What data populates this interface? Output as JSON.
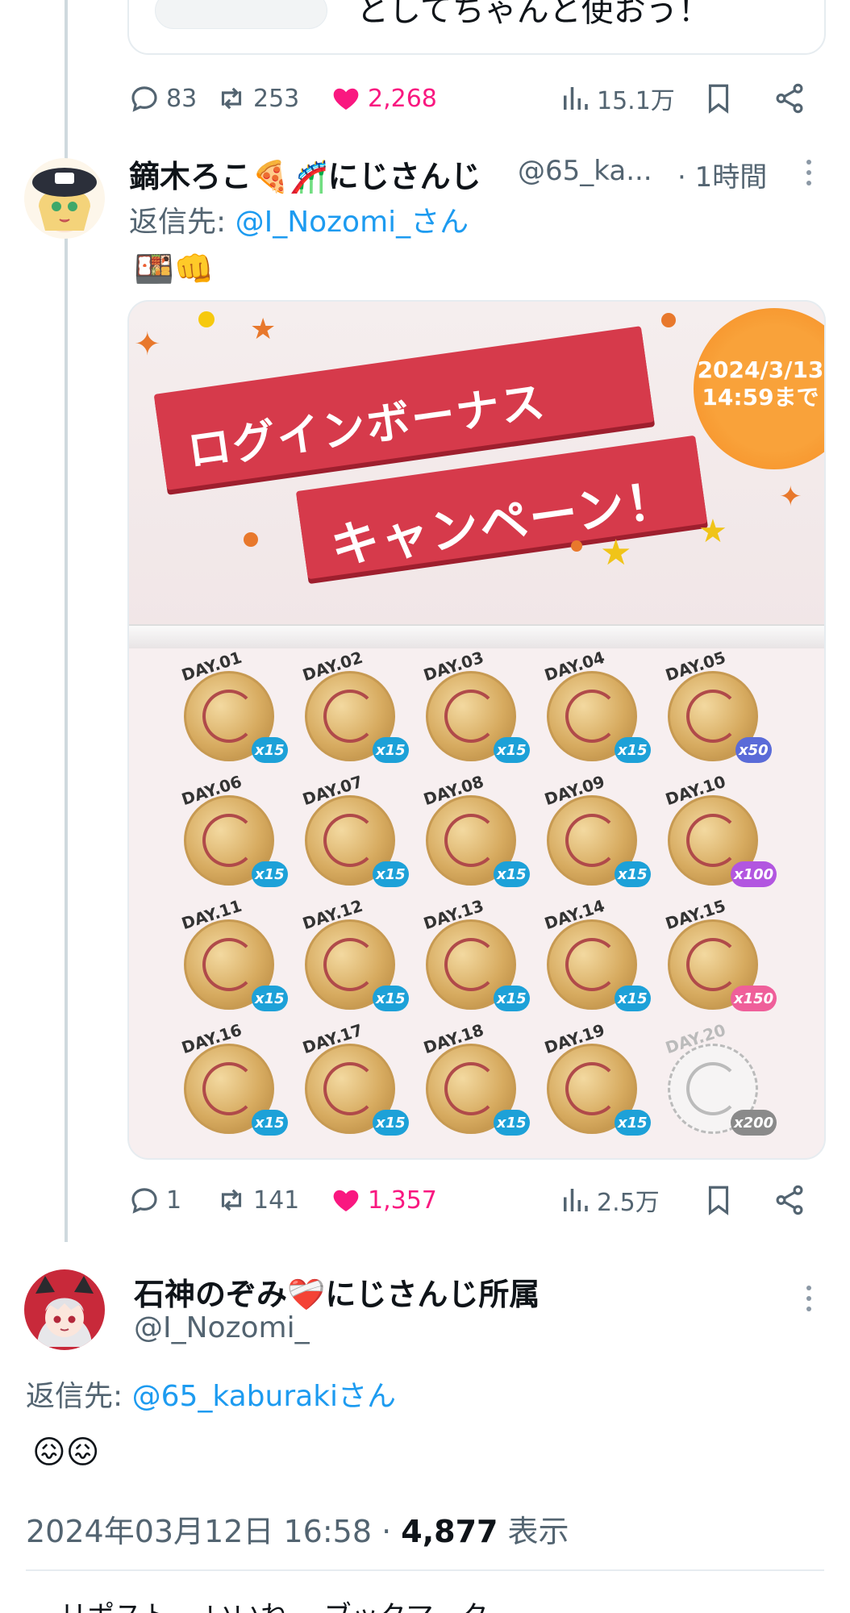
{
  "prev_tweet": {
    "cut_text": "としてちゃんと使おう！",
    "stats": {
      "replies": "83",
      "retweets": "253",
      "likes": "2,268",
      "views": "15.1万"
    }
  },
  "reply_tweet": {
    "name": "鏑木ろこ🍕🎢にじさんじ",
    "handle": "@65_ka...",
    "time": "· 1時間",
    "reply_label": "返信先: ",
    "reply_mention": "@I_Nozomi_さん",
    "emoji_text": "🍱👊",
    "image": {
      "banner_line1": "ログインボーナス",
      "banner_line2": "キャンペーン！",
      "deadline_date": "2024/3/13",
      "deadline_time": "14:59まで",
      "coins": [
        {
          "day": "DAY.01",
          "mult": "x15"
        },
        {
          "day": "DAY.02",
          "mult": "x15"
        },
        {
          "day": "DAY.03",
          "mult": "x15"
        },
        {
          "day": "DAY.04",
          "mult": "x15"
        },
        {
          "day": "DAY.05",
          "mult": "x50"
        },
        {
          "day": "DAY.06",
          "mult": "x15"
        },
        {
          "day": "DAY.07",
          "mult": "x15"
        },
        {
          "day": "DAY.08",
          "mult": "x15"
        },
        {
          "day": "DAY.09",
          "mult": "x15"
        },
        {
          "day": "DAY.10",
          "mult": "x100"
        },
        {
          "day": "DAY.11",
          "mult": "x15"
        },
        {
          "day": "DAY.12",
          "mult": "x15"
        },
        {
          "day": "DAY.13",
          "mult": "x15"
        },
        {
          "day": "DAY.14",
          "mult": "x15"
        },
        {
          "day": "DAY.15",
          "mult": "x150"
        },
        {
          "day": "DAY.16",
          "mult": "x15"
        },
        {
          "day": "DAY.17",
          "mult": "x15"
        },
        {
          "day": "DAY.18",
          "mult": "x15"
        },
        {
          "day": "DAY.19",
          "mult": "x15"
        },
        {
          "day": "DAY.20",
          "mult": "x200"
        }
      ]
    },
    "stats": {
      "replies": "1",
      "retweets": "141",
      "likes": "1,357",
      "views": "2.5万"
    }
  },
  "main_tweet": {
    "name": "石神のぞみ❤️‍🩹にじさんじ所属",
    "handle": "@I_Nozomi_",
    "reply_label": "返信先: ",
    "reply_mention": "@65_kaburakiさん",
    "emoji_text": "😖😖",
    "datetime": "2024年03月12日 16:58 · ",
    "views_count": "4,877",
    "views_label": " 表示"
  },
  "cutoff_text": "…リポスト …いいね …ブックマーク",
  "colors": {
    "like": "#f91880",
    "link": "#1d9bf0",
    "muted": "#536471",
    "ribbon": "#d63a4b"
  }
}
